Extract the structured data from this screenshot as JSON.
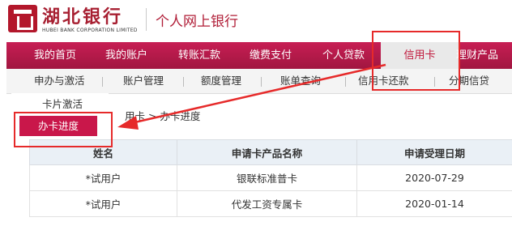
{
  "header": {
    "logo_cn": "湖北银行",
    "logo_en": "HUBEI BANK CORPORATION LIMITED",
    "site_title": "个人网上银行"
  },
  "nav": {
    "items": [
      {
        "label": "我的首页"
      },
      {
        "label": "我的账户"
      },
      {
        "label": "转账汇款"
      },
      {
        "label": "缴费支付"
      },
      {
        "label": "个人贷款"
      },
      {
        "label": "信用卡"
      },
      {
        "label": "理财产品"
      }
    ],
    "active": "信用卡"
  },
  "subnav": {
    "items": [
      {
        "label": "申办与激活"
      },
      {
        "label": "账户管理"
      },
      {
        "label": "额度管理"
      },
      {
        "label": "账单查询"
      },
      {
        "label": "信用卡还款"
      },
      {
        "label": "分期信贷"
      }
    ]
  },
  "dropdown": {
    "items": [
      {
        "label": "卡片激活"
      },
      {
        "label": "办卡进度"
      }
    ],
    "active": "办卡进度"
  },
  "breadcrumb": "用卡 > 办卡进度",
  "table": {
    "headers": [
      "姓名",
      "申请卡产品名称",
      "申请受理日期"
    ],
    "rows": [
      [
        "*试用户",
        "银联标准普卡",
        "2020-07-29"
      ],
      [
        "*试用户",
        "代发工资专属卡",
        "2020-01-14"
      ]
    ]
  },
  "colors": {
    "brand_red": "#b3172b",
    "nav_bg": "#b81a4b",
    "annotation_red": "#e62a2a"
  }
}
